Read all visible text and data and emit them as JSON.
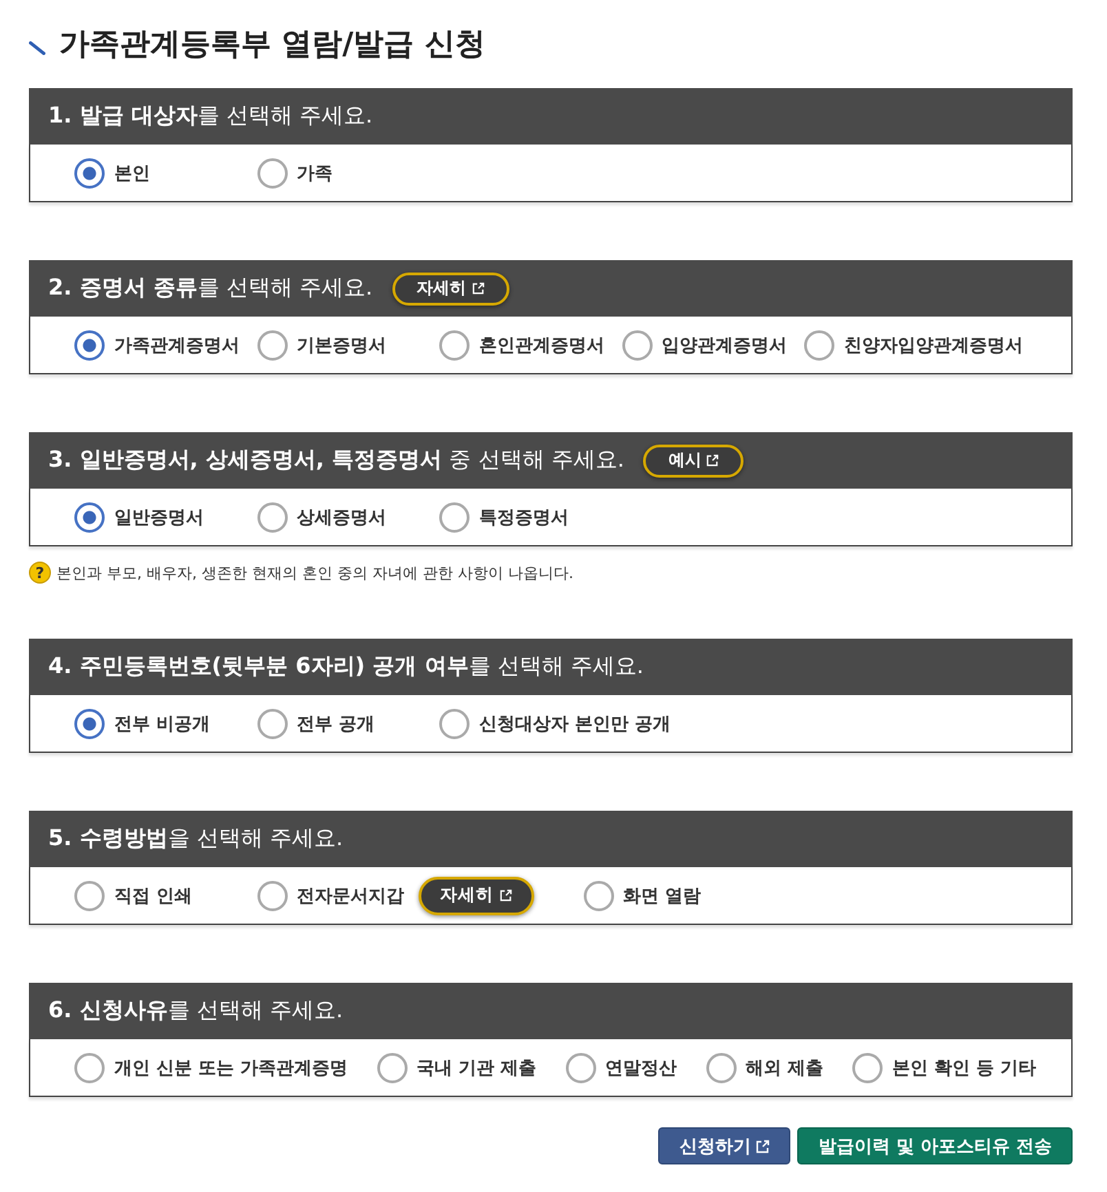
{
  "page_title": "가족관계등록부 열람/발급 신청",
  "sections": [
    {
      "title": "**1. 발급 대상자**를 선택해 주세요.",
      "options": [
        {
          "label": "본인",
          "selected": true
        },
        {
          "label": "가족",
          "selected": false
        }
      ]
    },
    {
      "title": "**2. 증명서 종류**를 선택해 주세요.",
      "header_button": {
        "label": "자세히"
      },
      "options": [
        {
          "label": "가족관계증명서",
          "selected": true
        },
        {
          "label": "기본증명서",
          "selected": false
        },
        {
          "label": "혼인관계증명서",
          "selected": false
        },
        {
          "label": "입양관계증명서",
          "selected": false
        },
        {
          "label": "친양자입양관계증명서",
          "selected": false
        }
      ]
    },
    {
      "title": "**3. 일반증명서, 상세증명서, 특정증명서** 중 선택해 주세요.",
      "header_button": {
        "label": "예시"
      },
      "options": [
        {
          "label": "일반증명서",
          "selected": true
        },
        {
          "label": "상세증명서",
          "selected": false
        },
        {
          "label": "특정증명서",
          "selected": false
        }
      ],
      "hint": {
        "icon": "?",
        "text": "본인과 부모, 배우자, 생존한 현재의 혼인 중의 자녀에 관한 사항이 나옵니다."
      }
    },
    {
      "title": "**4. 주민등록번호(뒷부분 6자리) 공개 여부**를 선택해 주세요.",
      "options": [
        {
          "label": "전부 비공개",
          "selected": true
        },
        {
          "label": "전부 공개",
          "selected": false
        },
        {
          "label": "신청대상자 본인만 공개",
          "selected": false
        }
      ]
    },
    {
      "title": "**5. 수령방법**을 선택해 주세요.",
      "options": [
        {
          "label": "직접 인쇄",
          "selected": false
        },
        {
          "label": "전자문서지갑",
          "selected": false,
          "button": {
            "label": "자세히"
          }
        },
        {
          "label": "화면 열람",
          "selected": false
        }
      ]
    },
    {
      "title": "**6. 신청사유**를 선택해 주세요.",
      "options": [
        {
          "label": "개인 신분 또는 가족관계증명",
          "selected": false
        },
        {
          "label": "국내 기관 제출",
          "selected": false
        },
        {
          "label": "연말정산",
          "selected": false
        },
        {
          "label": "해외 제출",
          "selected": false
        },
        {
          "label": "본인 확인 등 기타",
          "selected": false
        }
      ]
    }
  ],
  "actions": [
    {
      "label": "신청하기",
      "kind": "primary"
    },
    {
      "label": "발급이력 및 아포스티유 전송",
      "kind": "secondary"
    }
  ]
}
